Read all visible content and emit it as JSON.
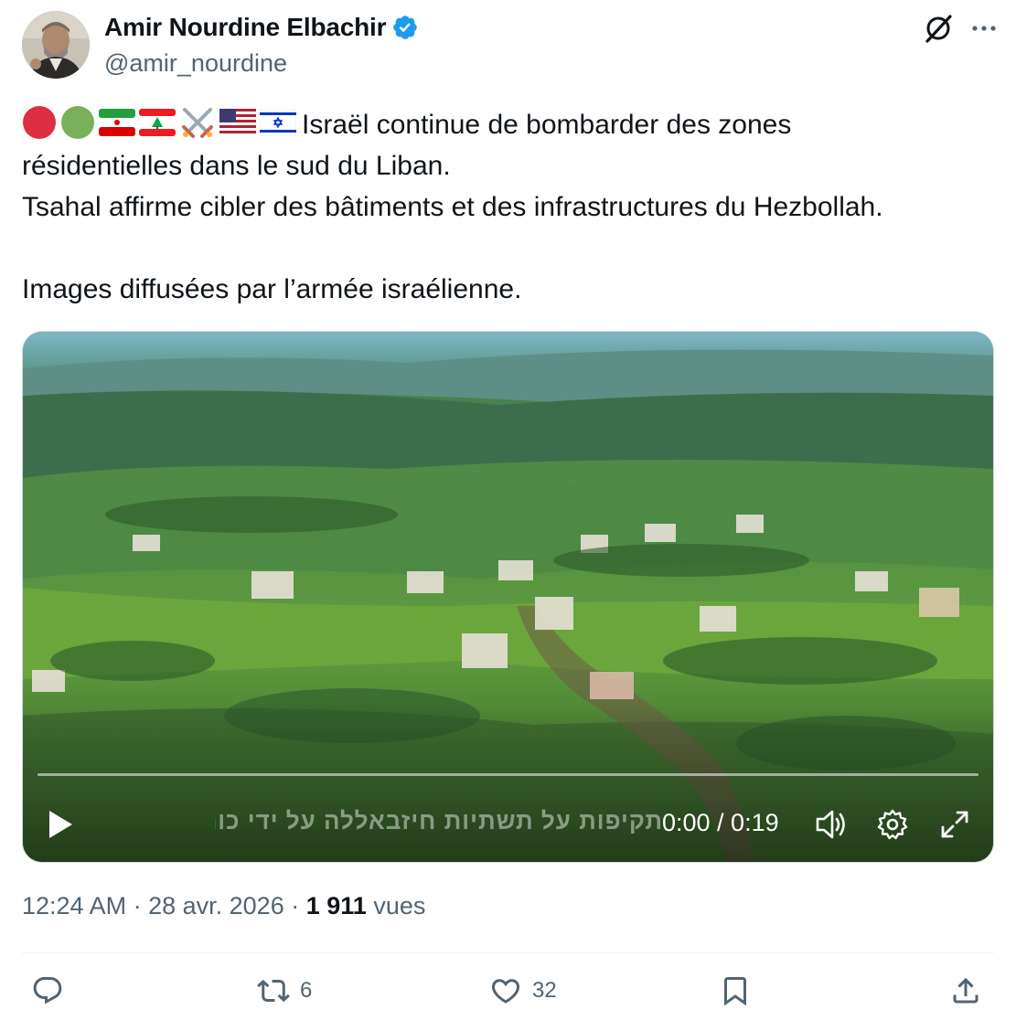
{
  "author": {
    "name": "Amir Nourdine Elbachir",
    "handle": "@amir_nourdine",
    "verified_color": "#1d9bf0"
  },
  "tweet": {
    "emoji_icons": [
      "red-circle",
      "green-circle",
      "iran-flag",
      "lebanon-flag",
      "crossed-swords",
      "usa-flag",
      "israel-flag"
    ],
    "line1": "Israël continue de bombarder des zones",
    "line2": "résidentielles dans le sud du Liban.",
    "line3": "Tsahal affirme cibler des bâtiments et des infrastructures du Hezbollah.",
    "line4": "Images diffusées par l’armée israélienne."
  },
  "video": {
    "caption": "תקיפות על תשתיות חיזבאללה על ידי כוחות חטיבת גולני בדרום לבנון",
    "current_time": "0:00",
    "duration": "0:19",
    "time_label": "0:00 / 0:19",
    "progress": 0
  },
  "meta": {
    "time": "12:24 AM",
    "date": "28 avr. 2026",
    "views_count": "1 911",
    "views_label": "vues"
  },
  "actions": {
    "reply_count": "",
    "retweet_count": "6",
    "like_count": "32"
  }
}
